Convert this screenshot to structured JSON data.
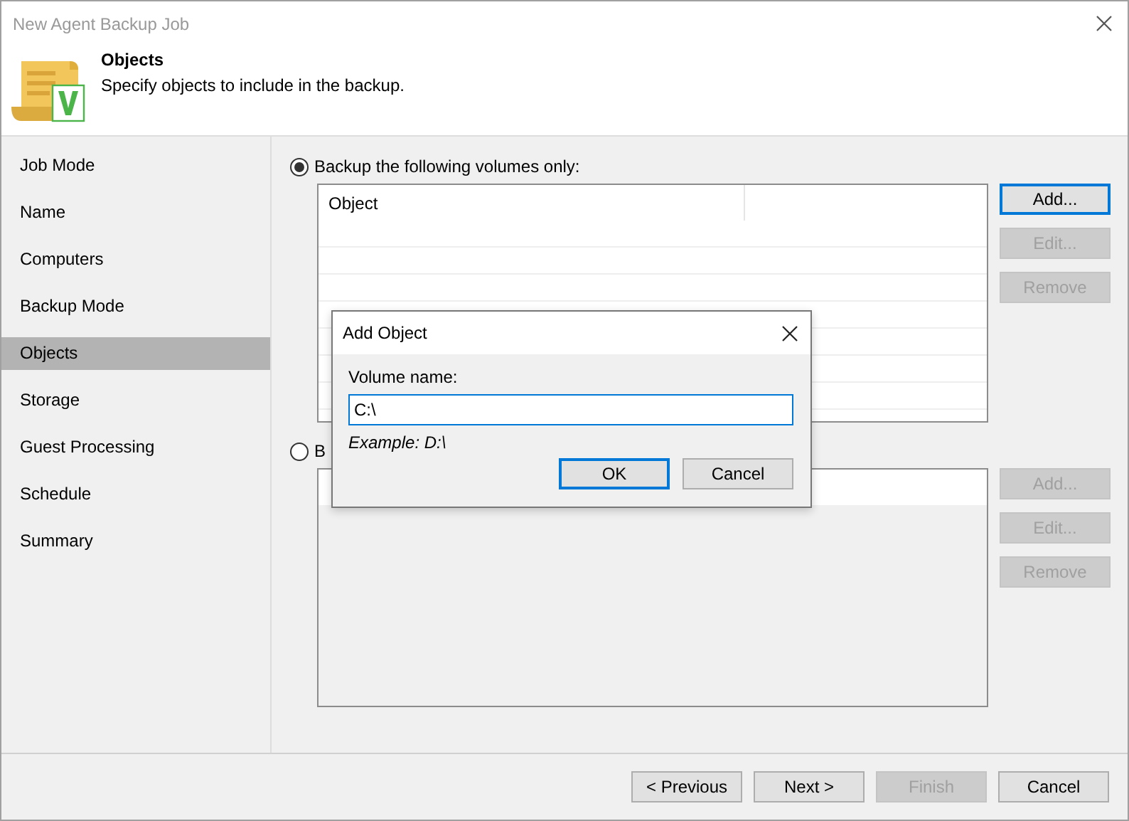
{
  "window": {
    "title": "New Agent Backup Job"
  },
  "header": {
    "title": "Objects",
    "subtitle": "Specify objects to include in the backup."
  },
  "steps": [
    {
      "label": "Job Mode",
      "selected": false
    },
    {
      "label": "Name",
      "selected": false
    },
    {
      "label": "Computers",
      "selected": false
    },
    {
      "label": "Backup Mode",
      "selected": false
    },
    {
      "label": "Objects",
      "selected": true
    },
    {
      "label": "Storage",
      "selected": false
    },
    {
      "label": "Guest Processing",
      "selected": false
    },
    {
      "label": "Schedule",
      "selected": false
    },
    {
      "label": "Summary",
      "selected": false
    }
  ],
  "options": [
    {
      "label": "Backup the following volumes only:",
      "selected": true,
      "enabled": true,
      "columns": [
        "Object"
      ],
      "buttons": [
        {
          "label": "Add...",
          "disabled": false,
          "focused": true
        },
        {
          "label": "Edit...",
          "disabled": true,
          "focused": false
        },
        {
          "label": "Remove",
          "disabled": true,
          "focused": false
        }
      ]
    },
    {
      "label": "B",
      "selected": false,
      "enabled": false,
      "buttons": [
        {
          "label": "Add...",
          "disabled": true,
          "focused": false
        },
        {
          "label": "Edit...",
          "disabled": true,
          "focused": false
        },
        {
          "label": "Remove",
          "disabled": true,
          "focused": false
        }
      ]
    }
  ],
  "dialog": {
    "title": "Add Object",
    "field_label": "Volume name:",
    "value": "C:\\",
    "example": "Example: D:\\",
    "buttons": [
      {
        "label": "OK",
        "focused": true
      },
      {
        "label": "Cancel",
        "focused": false
      }
    ]
  },
  "footer": {
    "buttons": [
      {
        "label": "< Previous",
        "disabled": false
      },
      {
        "label": "Next >",
        "disabled": false
      },
      {
        "label": "Finish",
        "disabled": true
      },
      {
        "label": "Cancel",
        "disabled": false
      }
    ]
  }
}
